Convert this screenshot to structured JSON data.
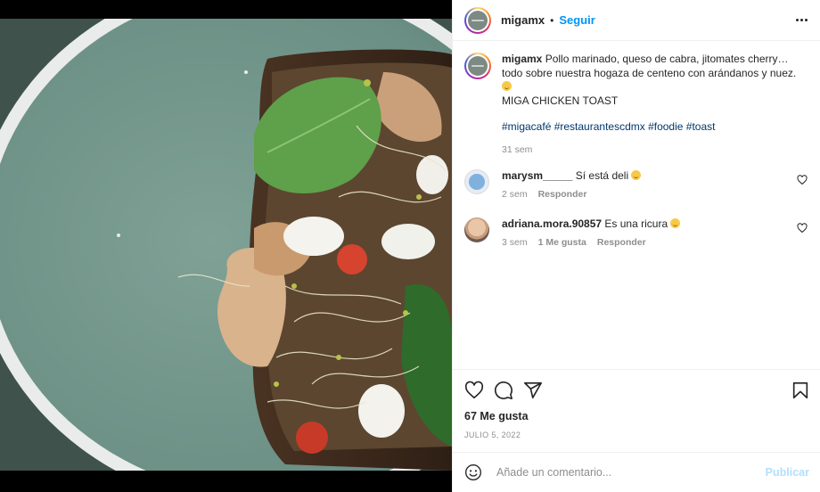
{
  "header": {
    "username": "migamx",
    "separator": "•",
    "follow_label": "Seguir"
  },
  "caption": {
    "username": "migamx",
    "text": "Pollo marinado, queso de cabra, jitomates cherry… todo sobre nuestra hogaza de centeno con arándanos y nuez.",
    "title": "MIGA CHICKEN TOAST",
    "hashtags": "#migacafé #restaurantescdmx #foodie #toast",
    "age": "31 sem"
  },
  "comments": [
    {
      "username": "marysm_____",
      "text": "Sí está deli",
      "age": "2 sem",
      "likes": "",
      "reply_label": "Responder"
    },
    {
      "username": "adriana.mora.90857",
      "text": "Es una ricura",
      "age": "3 sem",
      "likes": "1 Me gusta",
      "reply_label": "Responder"
    }
  ],
  "actions": {
    "icons": [
      "heart-icon",
      "comment-icon",
      "share-icon",
      "bookmark-icon"
    ],
    "likes": "67 Me gusta",
    "date": "JULIO 5, 2022"
  },
  "add_comment": {
    "placeholder": "Añade un comentario...",
    "publish_label": "Publicar"
  },
  "colors": {
    "accent": "#0095f6",
    "hashtag": "#00376b",
    "muted": "#8e8e8e",
    "publish_disabled": "#b2dffc"
  }
}
